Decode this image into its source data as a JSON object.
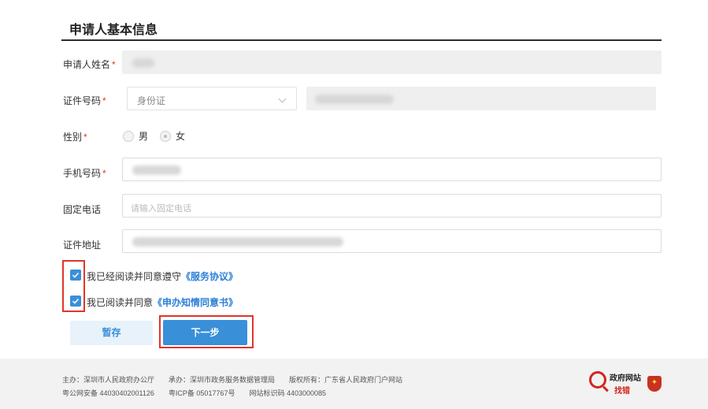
{
  "section": {
    "title": "申请人基本信息"
  },
  "form": {
    "name": {
      "label": "申请人姓名",
      "required": "*"
    },
    "id": {
      "label": "证件号码",
      "required": "*",
      "type_value": "身份证"
    },
    "gender": {
      "label": "性别",
      "required": "*",
      "options": [
        "男",
        "女"
      ],
      "selected": "女"
    },
    "phone": {
      "label": "手机号码",
      "required": "*"
    },
    "landline": {
      "label": "固定电话",
      "placeholder": "请输入固定电话"
    },
    "address": {
      "label": "证件地址"
    }
  },
  "agreements": [
    {
      "text": "我已经阅读并同意遵守",
      "link": "《服务协议》",
      "checked": true
    },
    {
      "text": "我已阅读并同意",
      "link": "《申办知情同意书》",
      "checked": true
    }
  ],
  "buttons": {
    "save": "暂存",
    "next": "下一步"
  },
  "footer": {
    "host": "主办：深圳市人民政府办公厅",
    "organizer": "承办：深圳市政务服务数据管理局",
    "copyright": "版权所有：广东省人民政府门户网站",
    "police": "粤公网安备 44030402001126",
    "icp": "粤ICP备 05017767号",
    "site_code": "网站标识码 4403000085",
    "badge_line1": "政府网站",
    "badge_line2": "找错"
  },
  "colors": {
    "accent": "#3a8fd9",
    "highlight": "#e0352b",
    "required": "#e0352b"
  }
}
